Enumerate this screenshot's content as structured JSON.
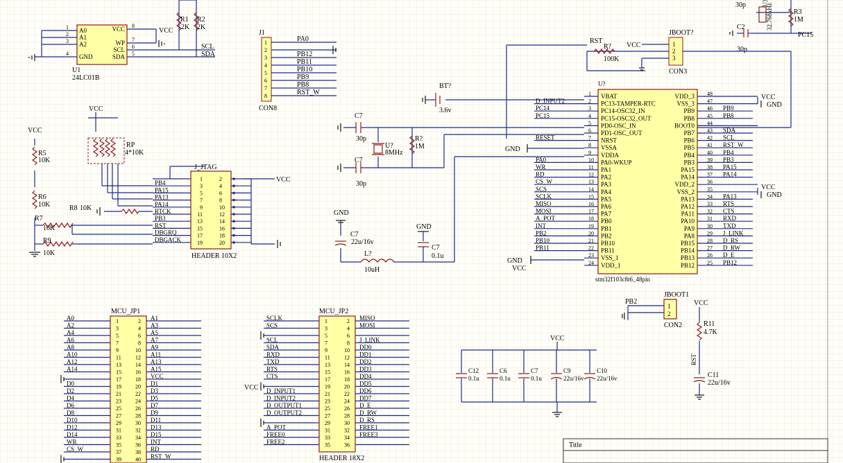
{
  "eeprom": {
    "ref": "U1",
    "part": "24LC01B",
    "left_pins": [
      [
        "1",
        "A0"
      ],
      [
        "2",
        "A1"
      ],
      [
        "3",
        "A2"
      ],
      [
        "4",
        "GND"
      ]
    ],
    "right_pins": [
      [
        "8",
        "VCC"
      ],
      [
        "7",
        "WP"
      ],
      [
        "6",
        "SCL"
      ],
      [
        "5",
        "SDA"
      ]
    ],
    "vcc": "VCC",
    "scl": "SCL",
    "sda": "SDA",
    "r1": "R1",
    "r1v": "2K",
    "r2": "R2",
    "r2v": "2K"
  },
  "j1": {
    "ref": "J1",
    "type": "CON8",
    "pins": [
      "1",
      "2",
      "3",
      "4",
      "5",
      "6",
      "7",
      "8"
    ],
    "nets": [
      "PA0",
      "",
      "PB12",
      "PB11",
      "PB10",
      "PB9",
      "PB8",
      "RST_W"
    ]
  },
  "crystal32k": {
    "cap_top": "30p",
    "part": "U3",
    "freq": "32.768kHz",
    "r3": "R3",
    "r3v": "1M",
    "c2": "C2",
    "c2v": "30p",
    "pc15": "PC15"
  },
  "jboot0": {
    "ref": "JBOOT?",
    "type": "CON3",
    "rst": "RST",
    "r7": "R?",
    "r7v": "100K",
    "vcc": "VCC",
    "pins": [
      "1",
      "2",
      "3"
    ]
  },
  "bt": {
    "ref": "BT?",
    "value": "3.6v"
  },
  "osc": {
    "c7a": "C7",
    "c7a_v": "30p",
    "u7": "U?",
    "freq": "8MHz",
    "r7": "R?",
    "r7v": "1M",
    "c7b": "C7",
    "c7b_v": "30p"
  },
  "power_filter": {
    "gnd1": "GND",
    "c7": "C7",
    "c7v": "22u/16v",
    "l": "L?",
    "lv": "10uH",
    "gnd2": "GND",
    "c7s": "C7",
    "c7s_v": "0.1u"
  },
  "mcu": {
    "ref": "U?",
    "part": "stm32f103c8t6_48pin",
    "left_pins": [
      [
        "1",
        "VBAT",
        ""
      ],
      [
        "2",
        "PC13-TAMPER-RTC",
        "D_INPUT2"
      ],
      [
        "3",
        "PC14-OSC32_IN",
        "PC14"
      ],
      [
        "4",
        "PC15-OSC32_OUT",
        "PC15"
      ],
      [
        "5",
        "PD0-OSC_IN",
        ""
      ],
      [
        "6",
        "PD1-OSC_OUT",
        ""
      ],
      [
        "7",
        "NRST",
        "RESET"
      ],
      [
        "8",
        "VSSA",
        ""
      ],
      [
        "9",
        "VDDA",
        ""
      ],
      [
        "10",
        "PA0-WKUP",
        "PA0"
      ],
      [
        "11",
        "PA1",
        "WR"
      ],
      [
        "12",
        "PA2",
        "RD"
      ],
      [
        "13",
        "PA3",
        "CS_W"
      ],
      [
        "14",
        "PA4",
        "SCS"
      ],
      [
        "15",
        "PA5",
        "SCLK"
      ],
      [
        "16",
        "PA6",
        "MISO"
      ],
      [
        "17",
        "PA7",
        "MOSI"
      ],
      [
        "18",
        "PB0",
        "A_POT"
      ],
      [
        "19",
        "PB1",
        "INT"
      ],
      [
        "20",
        "PB2",
        "PB2"
      ],
      [
        "21",
        "PB10",
        "PB10"
      ],
      [
        "22",
        "PB11",
        "PB11"
      ],
      [
        "23",
        "VSS_1",
        ""
      ],
      [
        "24",
        "VDD_1",
        ""
      ]
    ],
    "right_pins": [
      [
        "48",
        "VDD_3",
        ""
      ],
      [
        "47",
        "VSS_3",
        ""
      ],
      [
        "46",
        "PB9",
        "PB9"
      ],
      [
        "45",
        "PB8",
        "PB8"
      ],
      [
        "44",
        "BOOT0",
        ""
      ],
      [
        "43",
        "PB7",
        "SDA"
      ],
      [
        "42",
        "PB6",
        "SCL"
      ],
      [
        "41",
        "PB5",
        "RST_W"
      ],
      [
        "40",
        "PB4",
        "PB4"
      ],
      [
        "39",
        "PB3",
        "PB3"
      ],
      [
        "38",
        "PA15",
        "PA15"
      ],
      [
        "37",
        "PA14",
        "PA14"
      ],
      [
        "36",
        "VDD_2",
        ""
      ],
      [
        "35",
        "VSS_2",
        ""
      ],
      [
        "34",
        "PA13",
        "PA13"
      ],
      [
        "33",
        "PA12",
        "RTS"
      ],
      [
        "32",
        "PA11",
        "CTS"
      ],
      [
        "31",
        "PA10",
        "RXD"
      ],
      [
        "30",
        "PA9",
        "TXD"
      ],
      [
        "29",
        "PA8",
        "J_LINK"
      ],
      [
        "28",
        "PB15",
        "D_RS"
      ],
      [
        "27",
        "PB14",
        "D_RW"
      ],
      [
        "26",
        "PB13",
        "D_E"
      ],
      [
        "25",
        "PB12",
        "PB12"
      ]
    ],
    "gnd": "GND",
    "vcc": "VCC"
  },
  "jtag": {
    "ref": "J_JTAG",
    "type": "HEADER 10X2",
    "vcc": "VCC",
    "left": [
      [
        "1",
        ""
      ],
      [
        "3",
        "PB4"
      ],
      [
        "5",
        "PA15"
      ],
      [
        "7",
        "PA13"
      ],
      [
        "9",
        "PA14"
      ],
      [
        "11",
        "RTCK"
      ],
      [
        "13",
        "PB3"
      ],
      [
        "15",
        "RST"
      ],
      [
        "17",
        "DBGRQ"
      ],
      [
        "19",
        "DBGACK"
      ]
    ],
    "right": [
      "2",
      "4",
      "6",
      "8",
      "10",
      "12",
      "14",
      "16",
      "18",
      "20"
    ],
    "rp": "RP",
    "rpv": "4*10K",
    "r5": "R5",
    "r5v": "10K",
    "r6": "R6",
    "r6v": "10K",
    "r7": "R7",
    "r7v": "10K",
    "r8": "R8",
    "r8v": "10K",
    "r9": "R9",
    "r9v": "10K",
    "vcc_left": "VCC"
  },
  "mcu_jp1": {
    "title": "MCU_JP1",
    "left": [
      [
        "1",
        "A0"
      ],
      [
        "3",
        "A2"
      ],
      [
        "5",
        "A4"
      ],
      [
        "7",
        "A6"
      ],
      [
        "9",
        "A8"
      ],
      [
        "11",
        "A10"
      ],
      [
        "13",
        "A12"
      ],
      [
        "15",
        "A14"
      ],
      [
        "17",
        ""
      ],
      [
        "19",
        "D0"
      ],
      [
        "21",
        "D2"
      ],
      [
        "23",
        "D4"
      ],
      [
        "25",
        "D6"
      ],
      [
        "27",
        "D8"
      ],
      [
        "29",
        "D10"
      ],
      [
        "31",
        "D12"
      ],
      [
        "33",
        "D14"
      ],
      [
        "35",
        "WR"
      ],
      [
        "37",
        "CS_W"
      ],
      [
        "39",
        ""
      ]
    ],
    "right": [
      [
        "2",
        "A1"
      ],
      [
        "4",
        "A3"
      ],
      [
        "6",
        "A5"
      ],
      [
        "8",
        "A7"
      ],
      [
        "10",
        "A9"
      ],
      [
        "12",
        "A11"
      ],
      [
        "14",
        "A13"
      ],
      [
        "16",
        "A15"
      ],
      [
        "18",
        "VCC"
      ],
      [
        "20",
        "D1"
      ],
      [
        "22",
        "D3"
      ],
      [
        "24",
        "D5"
      ],
      [
        "26",
        "D7"
      ],
      [
        "28",
        "D9"
      ],
      [
        "30",
        "D11"
      ],
      [
        "32",
        "D13"
      ],
      [
        "34",
        "D15"
      ],
      [
        "36",
        "INT"
      ],
      [
        "38",
        "RD"
      ],
      [
        "40",
        "RST_W"
      ]
    ]
  },
  "mcu_jp2": {
    "title": "MCU_JP2",
    "type": "HEADER 18X2",
    "vcc": "VCC",
    "left": [
      [
        "1",
        "SCLK"
      ],
      [
        "3",
        "SCS"
      ],
      [
        "5",
        ""
      ],
      [
        "7",
        "SCL"
      ],
      [
        "9",
        "SDA"
      ],
      [
        "11",
        "RXD"
      ],
      [
        "13",
        "TXD"
      ],
      [
        "15",
        "RTS"
      ],
      [
        "17",
        "CTS"
      ],
      [
        "19",
        ""
      ],
      [
        "21",
        "D_INPUT1"
      ],
      [
        "23",
        "D_INPUT2"
      ],
      [
        "25",
        "D_OUTPUT1"
      ],
      [
        "27",
        "D_OUTPUT2"
      ],
      [
        "29",
        ""
      ],
      [
        "31",
        "A_POT"
      ],
      [
        "33",
        "FREE0"
      ],
      [
        "35",
        "FREE2"
      ]
    ],
    "right": [
      [
        "2",
        "MISO"
      ],
      [
        "4",
        "MOSI"
      ],
      [
        "6",
        ""
      ],
      [
        "8",
        "J_LINK"
      ],
      [
        "10",
        "DD0"
      ],
      [
        "12",
        "DD1"
      ],
      [
        "14",
        "DD2"
      ],
      [
        "16",
        "DD3"
      ],
      [
        "18",
        "DD4"
      ],
      [
        "20",
        "DD5"
      ],
      [
        "22",
        "DD6"
      ],
      [
        "24",
        "DD7"
      ],
      [
        "26",
        "D_E"
      ],
      [
        "28",
        "D_RW"
      ],
      [
        "30",
        "D_RS"
      ],
      [
        "32",
        "FREE1"
      ],
      [
        "34",
        "FREE3"
      ],
      [
        "36",
        ""
      ]
    ]
  },
  "decoupling": {
    "vcc": "VCC",
    "caps": [
      [
        "C12",
        "0.1u"
      ],
      [
        "C6",
        "0.1u"
      ],
      [
        "C7",
        "0.1u"
      ],
      [
        "C9",
        "22u/16v"
      ],
      [
        "C10",
        "22u/16v"
      ]
    ]
  },
  "jboot1": {
    "ref": "JBOOT1",
    "type": "CON2",
    "net": "PB2",
    "pins": [
      "1",
      "2"
    ]
  },
  "reset": {
    "vcc": "VCC",
    "r11": "R11",
    "r11v": "4.7K",
    "net": "RST",
    "c11": "C11",
    "c11v": "22u/16v"
  },
  "titleblock": {
    "title": "Title"
  },
  "colors": {
    "wire": "#1a2a8c",
    "part": "#8b1a1a",
    "body": "#ffffa6",
    "text": "#111111",
    "grid": "#e8e6dc"
  }
}
